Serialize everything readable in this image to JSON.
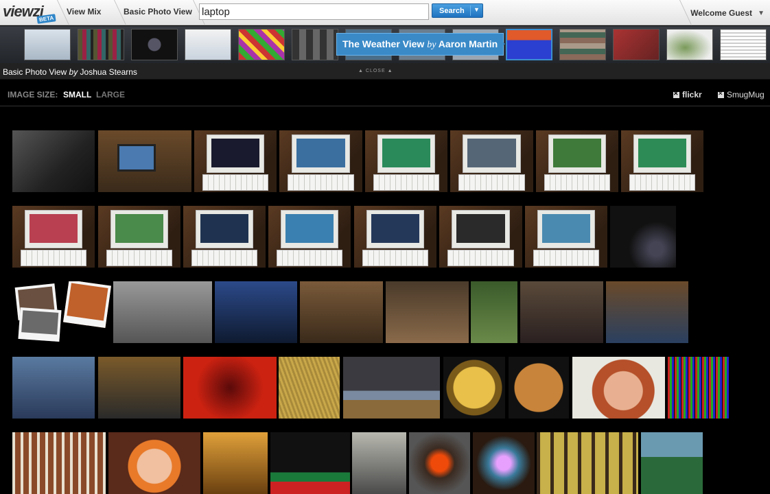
{
  "app": {
    "logo": "viewzi",
    "beta": "BETA",
    "nav": [
      "View Mix",
      "Basic Photo View"
    ],
    "search_value": "laptop",
    "search_button": "Search",
    "search_arrow": "▼",
    "welcome": "Welcome Guest",
    "welcome_arrow": "▼"
  },
  "mix": {
    "tip_title": "The Weather View",
    "tip_by": "by",
    "tip_author": "Aaron Martin",
    "view_title": "Basic Photo View",
    "view_by": "by",
    "view_author": "Joshua Stearns",
    "close": "CLOSE"
  },
  "sizebar": {
    "label": "IMAGE SIZE:",
    "small": "SMALL",
    "large": "LARGE",
    "sources": [
      "flickr",
      "SmugMug"
    ]
  },
  "colors": {
    "accent": "#3a8ac8",
    "background": "#000000"
  },
  "photos": [
    {
      "row": 0,
      "kind": "keyboard",
      "name": "photo-keyboard-closeup"
    },
    {
      "row": 0,
      "kind": "desk",
      "name": "photo-laptop-on-desk"
    },
    {
      "row": 0,
      "kind": "laptop",
      "screen": "#1a1a2e",
      "name": "photo-laptop-terminal"
    },
    {
      "row": 0,
      "kind": "laptop",
      "screen": "#3a6fa0",
      "name": "photo-laptop-install"
    },
    {
      "row": 0,
      "kind": "laptop",
      "screen": "#2a8a5a",
      "name": "photo-laptop-green"
    },
    {
      "row": 0,
      "kind": "laptop",
      "screen": "#556677",
      "name": "photo-laptop-dialog"
    },
    {
      "row": 0,
      "kind": "laptop",
      "screen": "#3f7a3a",
      "name": "photo-laptop-wallpaper"
    },
    {
      "row": 0,
      "kind": "laptop",
      "screen": "#2d8c55",
      "name": "photo-laptop-green-2"
    },
    {
      "row": 1,
      "kind": "laptop",
      "screen": "#b84050",
      "name": "photo-laptop-red-screen"
    },
    {
      "row": 1,
      "kind": "laptop",
      "screen": "#4a8a4a",
      "name": "photo-laptop-desktop"
    },
    {
      "row": 1,
      "kind": "laptop",
      "screen": "#1f3350",
      "name": "photo-laptop-boot"
    },
    {
      "row": 1,
      "kind": "laptop",
      "screen": "#3a80b0",
      "name": "photo-laptop-sky"
    },
    {
      "row": 1,
      "kind": "laptop",
      "screen": "#24385a",
      "name": "photo-laptop-menu"
    },
    {
      "row": 1,
      "kind": "laptop",
      "screen": "#2a2a2a",
      "name": "photo-laptop-console"
    },
    {
      "row": 1,
      "kind": "laptop",
      "screen": "#4a8ab0",
      "name": "photo-laptop-landscape"
    },
    {
      "row": 1,
      "kind": "night",
      "name": "photo-night-city"
    },
    {
      "row": 2,
      "kind": "polaroid",
      "name": "photo-polaroids"
    },
    {
      "row": 2,
      "kind": "grey",
      "name": "photo-grey-prints"
    },
    {
      "row": 2,
      "kind": "blue",
      "name": "photo-laptop-blue"
    },
    {
      "row": 2,
      "kind": "art",
      "name": "photo-painted-laptop"
    },
    {
      "row": 2,
      "kind": "white",
      "name": "photo-white-laptop"
    },
    {
      "row": 2,
      "kind": "ivy",
      "name": "photo-bag-ivy"
    },
    {
      "row": 2,
      "kind": "table",
      "name": "photo-laptop-table"
    },
    {
      "row": 2,
      "kind": "people",
      "name": "photo-women-laptop"
    },
    {
      "row": 3,
      "kind": "boy",
      "name": "photo-boy-computer"
    },
    {
      "row": 3,
      "kind": "browser",
      "name": "photo-laptop-browser"
    },
    {
      "row": 3,
      "kind": "red",
      "name": "photo-red-chair"
    },
    {
      "row": 3,
      "kind": "wheat",
      "name": "photo-wheat-field"
    },
    {
      "row": 3,
      "kind": "sky",
      "name": "photo-storm-tree"
    },
    {
      "row": 3,
      "kind": "watch",
      "name": "photo-pocket-watch"
    },
    {
      "row": 3,
      "kind": "bread",
      "name": "photo-bread"
    },
    {
      "row": 3,
      "kind": "face",
      "name": "photo-woman-portrait"
    },
    {
      "row": 3,
      "kind": "pixels",
      "name": "photo-rgb-pixels"
    },
    {
      "row": 4,
      "kind": "crib",
      "name": "photo-crib"
    },
    {
      "row": 4,
      "kind": "child",
      "name": "photo-child-helmet"
    },
    {
      "row": 4,
      "kind": "sidelaptop",
      "name": "photo-laptop-side"
    },
    {
      "row": 4,
      "kind": "santa",
      "name": "photo-santa-laptop"
    },
    {
      "row": 4,
      "kind": "guitar",
      "name": "photo-guitar-player"
    },
    {
      "row": 4,
      "kind": "fire",
      "name": "photo-fireplace"
    },
    {
      "row": 4,
      "kind": "gem",
      "name": "photo-gem"
    },
    {
      "row": 4,
      "kind": "forest",
      "name": "photo-forest"
    },
    {
      "row": 4,
      "kind": "palm",
      "name": "photo-palm-tree"
    }
  ]
}
